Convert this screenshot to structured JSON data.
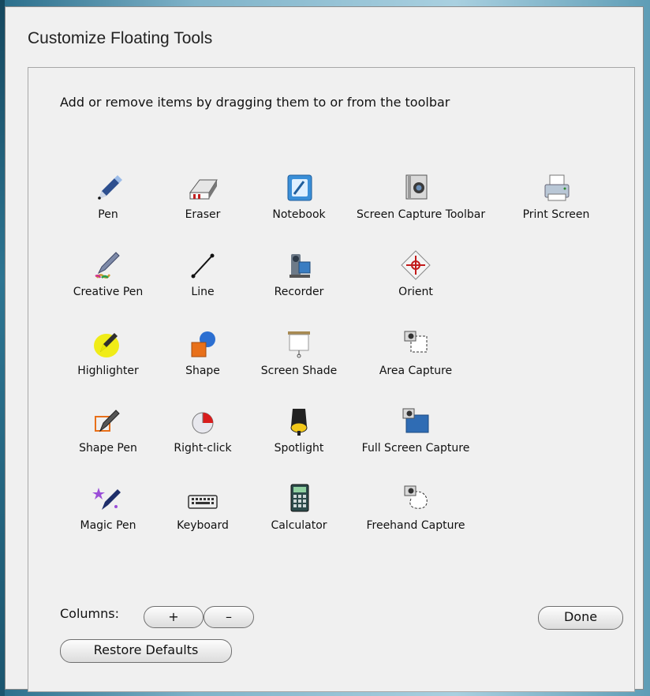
{
  "window": {
    "title": "Customize Floating Tools"
  },
  "instruction": "Add or remove items by dragging them to or from the toolbar",
  "tools": [
    {
      "label": "Pen",
      "icon": "pen-icon"
    },
    {
      "label": "Eraser",
      "icon": "eraser-icon"
    },
    {
      "label": "Notebook",
      "icon": "notebook-icon"
    },
    {
      "label": "Screen Capture Toolbar",
      "icon": "camera-icon"
    },
    {
      "label": "Print Screen",
      "icon": "printer-icon"
    },
    {
      "label": "Creative Pen",
      "icon": "creative-pen-icon"
    },
    {
      "label": "Line",
      "icon": "line-icon"
    },
    {
      "label": "Recorder",
      "icon": "recorder-icon"
    },
    {
      "label": "Orient",
      "icon": "orient-icon"
    },
    {
      "label": "Highlighter",
      "icon": "highlighter-icon"
    },
    {
      "label": "Shape",
      "icon": "shape-icon"
    },
    {
      "label": "Screen Shade",
      "icon": "screen-shade-icon"
    },
    {
      "label": "Area Capture",
      "icon": "area-capture-icon"
    },
    {
      "label": "Shape Pen",
      "icon": "shape-pen-icon"
    },
    {
      "label": "Right-click",
      "icon": "mouse-icon"
    },
    {
      "label": "Spotlight",
      "icon": "spotlight-icon"
    },
    {
      "label": "Full Screen Capture",
      "icon": "full-screen-capture-icon"
    },
    {
      "label": "Magic Pen",
      "icon": "magic-pen-icon"
    },
    {
      "label": "Keyboard",
      "icon": "keyboard-icon"
    },
    {
      "label": "Calculator",
      "icon": "calculator-icon"
    },
    {
      "label": "Freehand Capture",
      "icon": "freehand-capture-icon"
    }
  ],
  "controls": {
    "columns_label": "Columns:",
    "plus_label": "+",
    "minus_label": "–",
    "done_label": "Done",
    "restore_label": "Restore Defaults"
  }
}
